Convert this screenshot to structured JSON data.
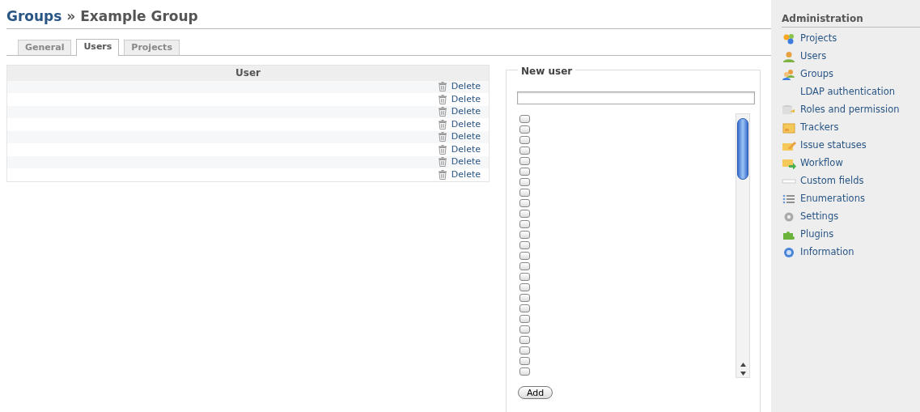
{
  "heading": {
    "parent": "Groups",
    "separator": "»",
    "current": "Example Group"
  },
  "tabs": [
    {
      "label": "General",
      "selected": false
    },
    {
      "label": "Users",
      "selected": true
    },
    {
      "label": "Projects",
      "selected": false
    }
  ],
  "users_table": {
    "columns": [
      "User"
    ],
    "rows": [
      {
        "action": "Delete"
      },
      {
        "action": "Delete"
      },
      {
        "action": "Delete"
      },
      {
        "action": "Delete"
      },
      {
        "action": "Delete"
      },
      {
        "action": "Delete"
      },
      {
        "action": "Delete"
      },
      {
        "action": "Delete"
      }
    ]
  },
  "new_user": {
    "legend": "New user",
    "candidates": [
      {
        "checked": false
      },
      {
        "checked": false
      },
      {
        "checked": false
      },
      {
        "checked": false
      },
      {
        "checked": false
      },
      {
        "checked": false
      },
      {
        "checked": false
      },
      {
        "checked": false
      },
      {
        "checked": false
      },
      {
        "checked": false
      },
      {
        "checked": false
      },
      {
        "checked": false
      },
      {
        "checked": false
      },
      {
        "checked": false
      },
      {
        "checked": false
      },
      {
        "checked": false
      },
      {
        "checked": false
      },
      {
        "checked": false
      },
      {
        "checked": false
      },
      {
        "checked": false
      },
      {
        "checked": false
      },
      {
        "checked": false
      },
      {
        "checked": false
      },
      {
        "checked": false
      },
      {
        "checked": false
      }
    ],
    "button": "Add"
  },
  "sidebar": {
    "title": "Administration",
    "items": [
      {
        "label": "Projects",
        "kind": "projects"
      },
      {
        "label": "Users",
        "kind": "users"
      },
      {
        "label": "Groups",
        "kind": "groups"
      },
      {
        "label": "LDAP authentication",
        "kind": "plain"
      },
      {
        "label": "Roles and permission",
        "kind": "roles"
      },
      {
        "label": "Trackers",
        "kind": "trackers"
      },
      {
        "label": "Issue statuses",
        "kind": "statuses"
      },
      {
        "label": "Workflow",
        "kind": "workflow"
      },
      {
        "label": "Custom fields",
        "kind": "fields"
      },
      {
        "label": "Enumerations",
        "kind": "enums"
      },
      {
        "label": "Settings",
        "kind": "settings"
      },
      {
        "label": "Plugins",
        "kind": "plugins"
      },
      {
        "label": "Information",
        "kind": "info"
      }
    ]
  }
}
